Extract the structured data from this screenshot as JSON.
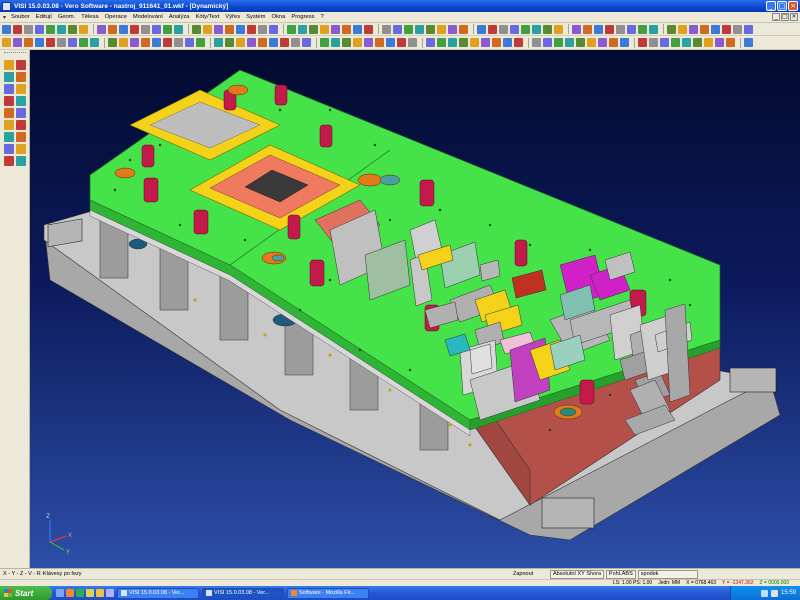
{
  "window": {
    "title": "VISI 15.0.03.08 - Vero Software - nastroj_911641_01.wkf - [Dynamický]",
    "min_glyph": "_",
    "max_glyph": "□",
    "close_glyph": "×"
  },
  "menu": {
    "items": [
      "Soubor",
      "Editují",
      "Geom.",
      "Tělesa",
      "Operace",
      "Modelování",
      "Analýza",
      "Kóty/Text",
      "Výřes",
      "Systém",
      "Okna",
      "Progress",
      "?"
    ],
    "mdi_min": "_",
    "mdi_max": "□",
    "mdi_close": "×"
  },
  "viewport": {
    "axis_x": "X",
    "axis_y": "Y",
    "axis_z": "Z",
    "colors": {
      "plate_green": "#45e24a",
      "base_grey": "#bdbdbd",
      "block_red": "#b4504a",
      "pin_red": "#c21a4a",
      "yellow": "#f4d21a",
      "salmon": "#f07a60",
      "magenta": "#d020c8"
    }
  },
  "status": {
    "mode": "X - Y - Z - V - R -",
    "hint": "Klávesy po fezy",
    "snap": "Zapnout",
    "coord_system": "Absolutní XY Shora",
    "view": "PohLABS",
    "layer": "spodek",
    "ls_ps": "LS: 1.00 PS: 1.00",
    "units": "Jedn: MM",
    "x_coord": "X = 0768.463",
    "y_coord": "Y = -1347.362",
    "z_coord": "Z = 0000.000"
  },
  "taskbar": {
    "start_label": "Start",
    "tasks": [
      {
        "label": "VISI 15.0.03.08 - Ver...",
        "active": false
      },
      {
        "label": "VISI 15.0.03.08 - Ver...",
        "active": true
      },
      {
        "label": "Software - Mozilla Fir...",
        "active": false
      }
    ],
    "clock": "15:59"
  }
}
